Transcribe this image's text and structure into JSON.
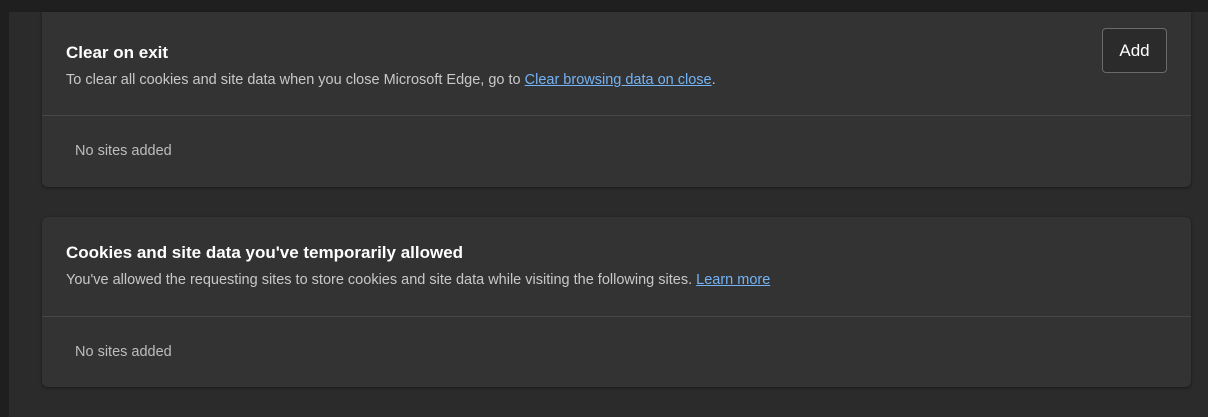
{
  "clear_on_exit": {
    "title": "Clear on exit",
    "description_prefix": "To clear all cookies and site data when you close Microsoft Edge, go to ",
    "link_text": "Clear browsing data on close",
    "description_suffix": ".",
    "add_label": "Add",
    "empty_text": "No sites added"
  },
  "temporarily_allowed": {
    "title": "Cookies and site data you've temporarily allowed",
    "description_prefix": "You've allowed the requesting sites to store cookies and site data while visiting the following sites. ",
    "link_text": "Learn more",
    "empty_text": "No sites added"
  },
  "colors": {
    "background": "#2b2b2b",
    "card": "#333333",
    "link": "#74b3f5",
    "text_primary": "#ffffff",
    "text_secondary": "#c8c8c8"
  }
}
